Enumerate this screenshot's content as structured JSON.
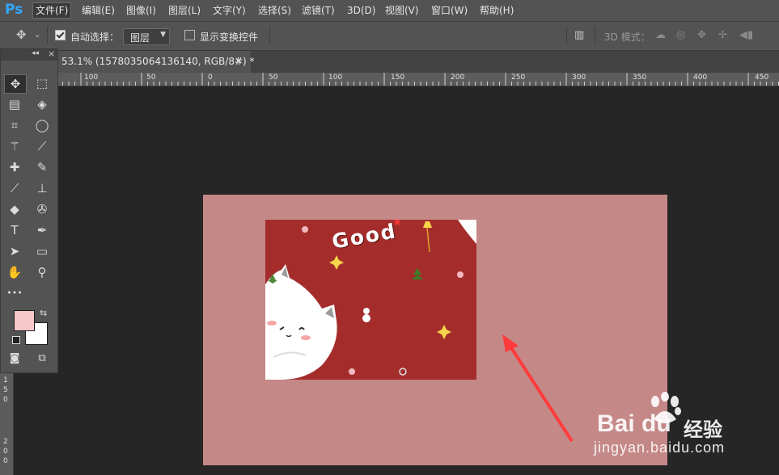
{
  "app": {
    "logo": "Ps"
  },
  "menu": [
    "文件(F)",
    "编辑(E)",
    "图像(I)",
    "图层(L)",
    "文字(Y)",
    "选择(S)",
    "滤镜(T)",
    "3D(D)",
    "视图(V)",
    "窗口(W)",
    "帮助(H)"
  ],
  "options": {
    "auto_select_label": "自动选择：",
    "auto_select_checked": true,
    "auto_select_target": "图层",
    "show_transform_label": "显示变换控件",
    "show_transform_checked": false,
    "mode_3d_label": "3D 模式："
  },
  "document_tab": {
    "title": "53.1% (1578035064136140, RGB/8#) *",
    "close": "×"
  },
  "ruler": {
    "h_labels": [
      "100",
      "50",
      "0",
      "50",
      "100",
      "150",
      "200",
      "250",
      "300",
      "350",
      "400",
      "450"
    ],
    "v_labels": [
      "1",
      "5",
      "0",
      "2",
      "0",
      "0"
    ]
  },
  "tools_panel": {
    "collapse": "◂◂",
    "close": "×",
    "more": "•••"
  },
  "colors": {
    "foreground": "#f5c9c9",
    "background": "#ffffff",
    "canvas": "#c48887",
    "artwork": "#a42d2c",
    "arrow": "#ff3b3b"
  },
  "artwork": {
    "text": "Good"
  },
  "watermark": {
    "brand": "Bai du",
    "brand_cn": "经验",
    "url": "jingyan.baidu.com"
  }
}
